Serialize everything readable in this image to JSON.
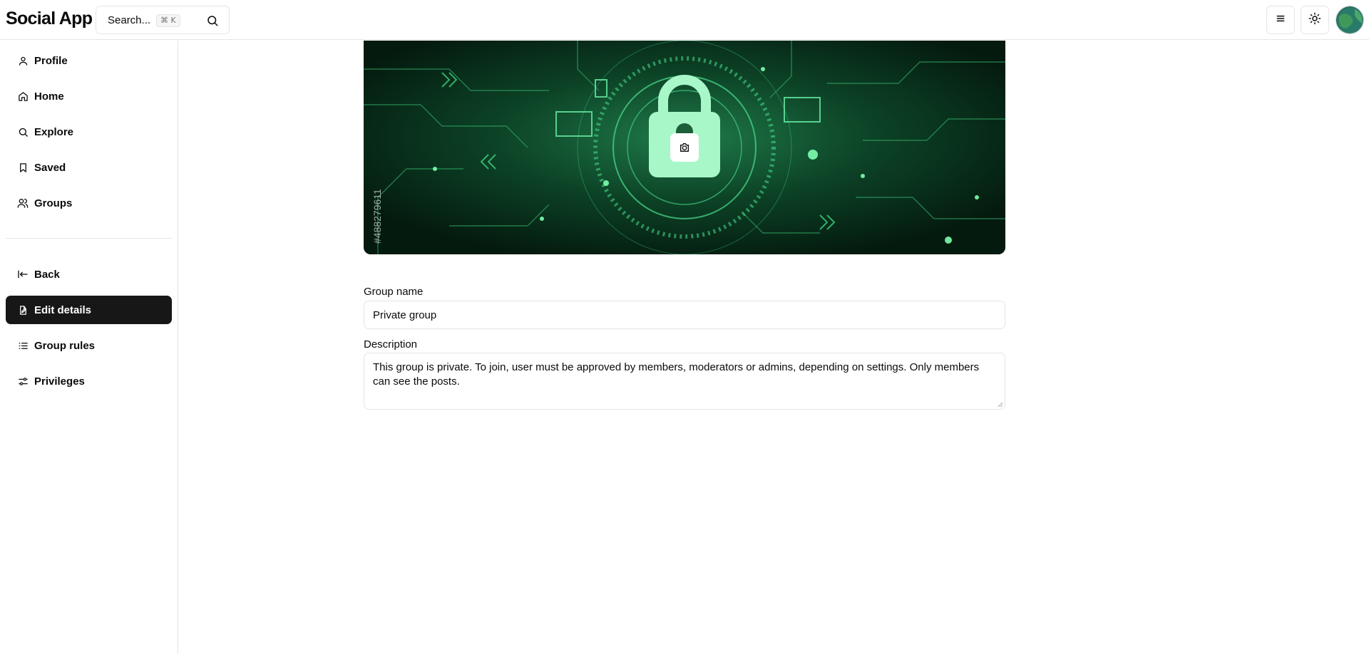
{
  "header": {
    "app_title": "Social App",
    "search_placeholder": "Search...",
    "search_shortcut": "⌘ K",
    "icons": [
      "search-icon",
      "menu-icon",
      "sun-icon",
      "avatar"
    ]
  },
  "sidebar": {
    "top_items": [
      {
        "label": "Profile",
        "icon": "user-icon"
      },
      {
        "label": "Home",
        "icon": "home-icon"
      },
      {
        "label": "Explore",
        "icon": "search-icon"
      },
      {
        "label": "Saved",
        "icon": "bookmark-icon"
      },
      {
        "label": "Groups",
        "icon": "users-icon"
      }
    ],
    "bottom_items": [
      {
        "label": "Back",
        "icon": "arrow-left-to-line-icon",
        "active": false
      },
      {
        "label": "Edit details",
        "icon": "edit-file-icon",
        "active": true
      },
      {
        "label": "Group rules",
        "icon": "list-icon",
        "active": false
      },
      {
        "label": "Privileges",
        "icon": "settings-sliders-icon",
        "active": false
      }
    ]
  },
  "banner": {
    "overlay_text": "#488279611",
    "image": "green-circuit-padlock-banner",
    "upload_icon": "camera-icon"
  },
  "form": {
    "group_name_label": "Group name",
    "group_name_value": "Private group",
    "description_label": "Description",
    "description_value": "This group is private. To join, user must be approved by members, moderators or admins, depending on settings. Only members can see the posts."
  },
  "colors": {
    "active_bg": "#171717",
    "border": "#e5e5e5",
    "banner_green": "#3ddc84"
  }
}
